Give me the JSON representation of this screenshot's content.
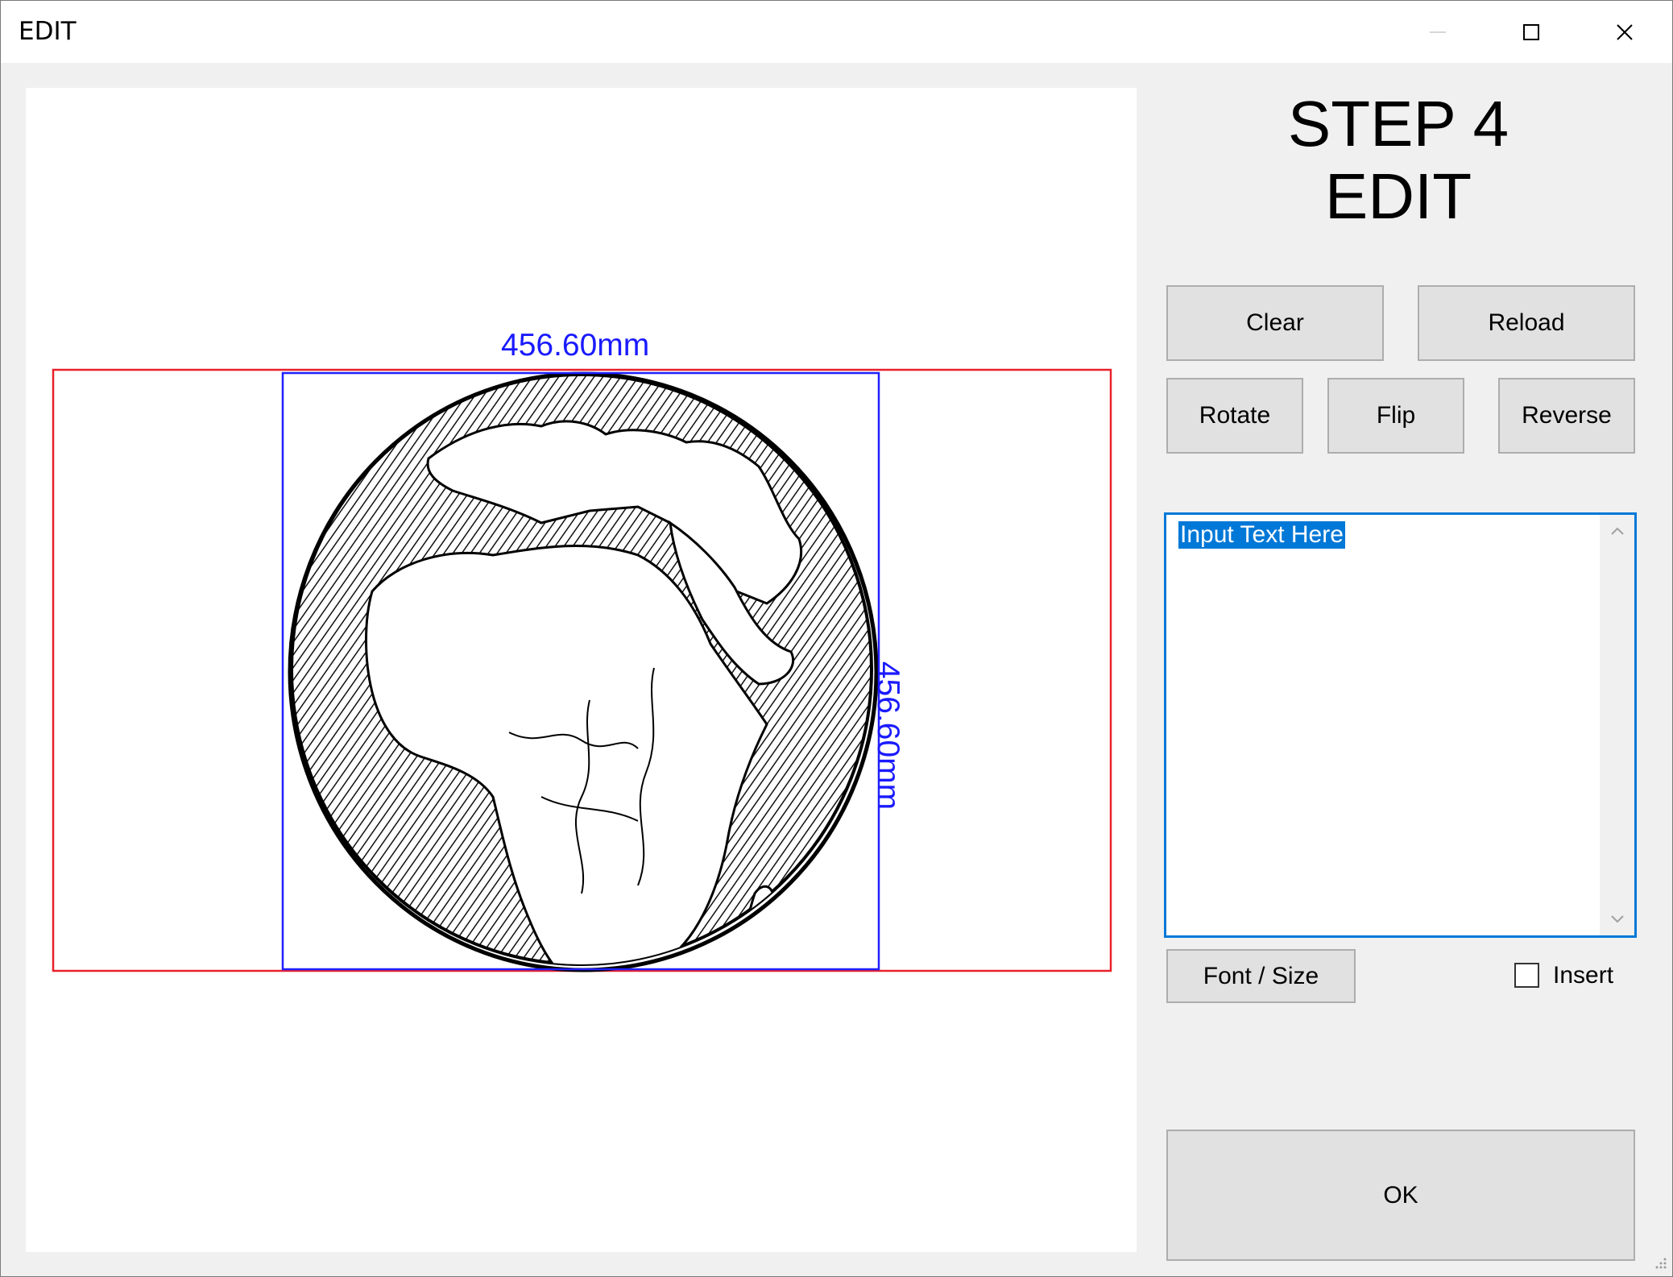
{
  "window": {
    "title": "EDIT",
    "controls": {
      "minimize": "minimize-icon",
      "maximize": "maximize-icon",
      "close": "close-icon"
    }
  },
  "canvas": {
    "width_label": "456.60mm",
    "height_label": "456.60mm",
    "image": "earth-globe-africa-sketch",
    "colors": {
      "outer_frame": "#e8212b",
      "selection_frame": "#2020ff"
    }
  },
  "panel": {
    "step_line1": "STEP 4",
    "step_line2": "EDIT",
    "buttons": {
      "clear": "Clear",
      "reload": "Reload",
      "rotate": "Rotate",
      "flip": "Flip",
      "reverse": "Reverse",
      "font_size": "Font / Size",
      "ok": "OK"
    },
    "text_input": {
      "value": "Input Text Here"
    },
    "insert_checkbox": {
      "label": "Insert",
      "checked": false
    }
  }
}
